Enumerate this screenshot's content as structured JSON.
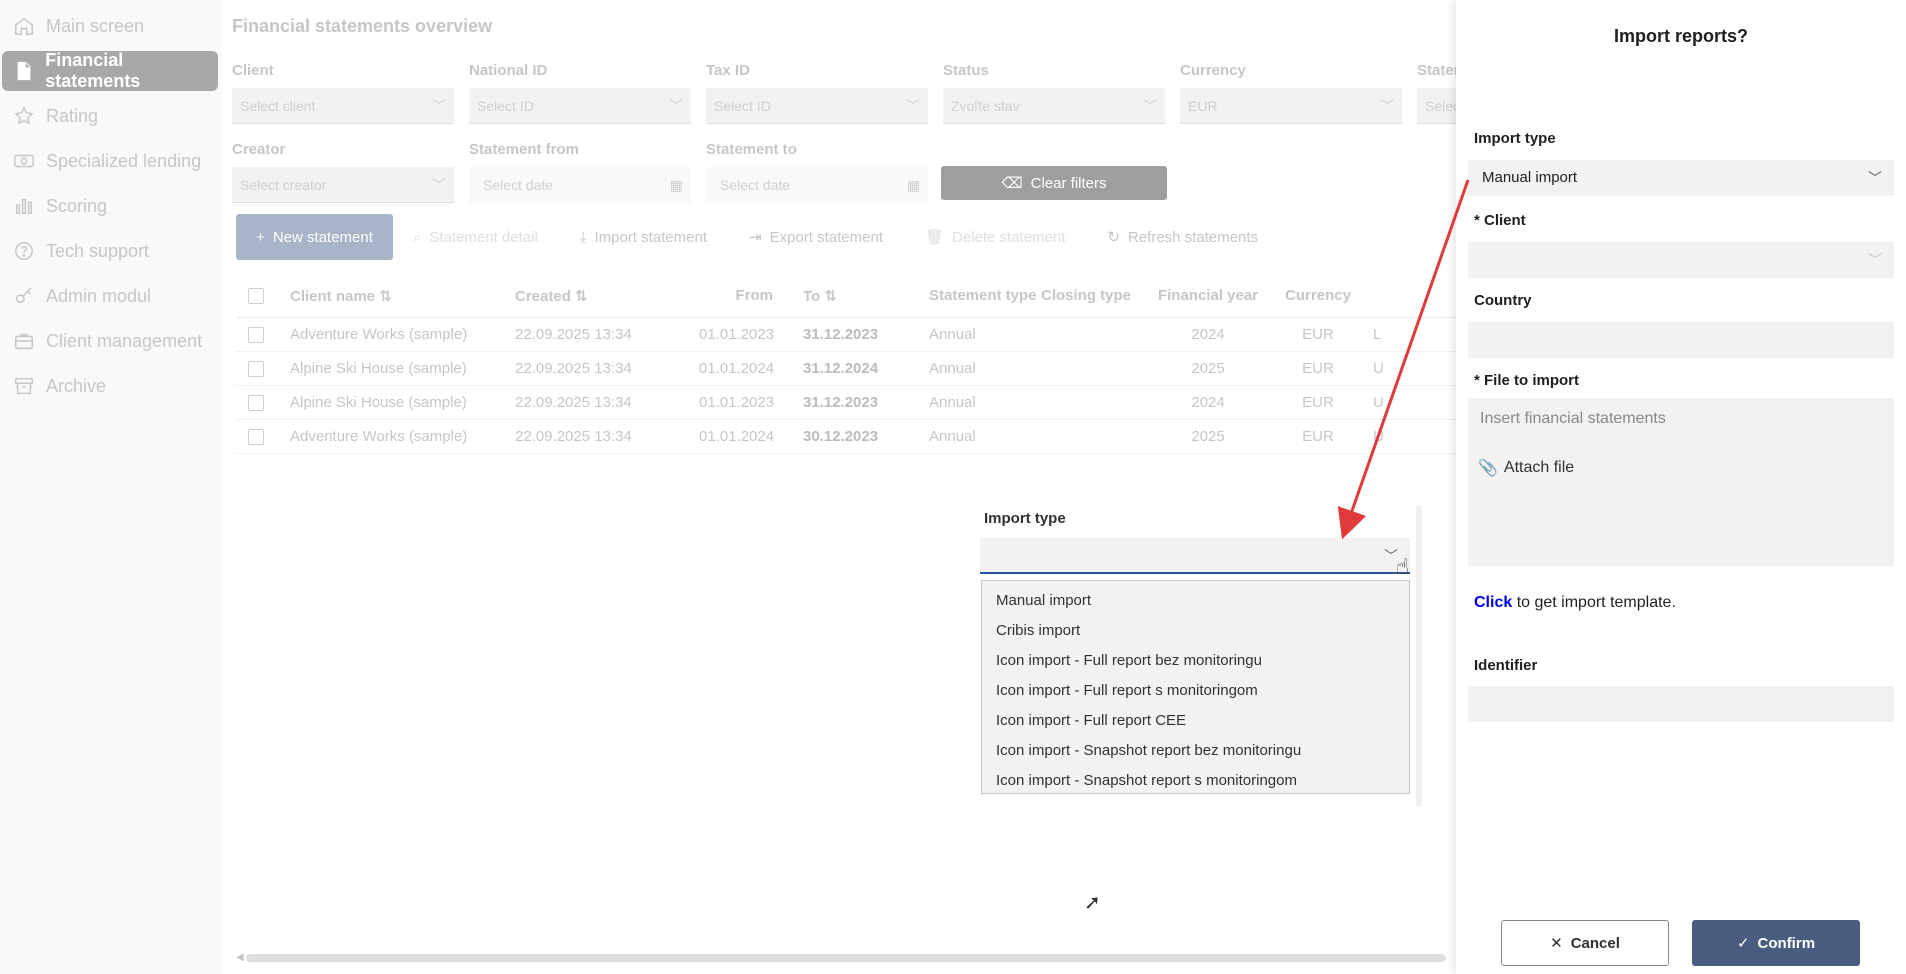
{
  "sidebar": {
    "items": [
      {
        "label": "Main screen",
        "icon": "home-icon"
      },
      {
        "label": "Financial statements",
        "icon": "document-icon",
        "active": true
      },
      {
        "label": "Rating",
        "icon": "star-icon"
      },
      {
        "label": "Specialized lending",
        "icon": "money-icon"
      },
      {
        "label": "Scoring",
        "icon": "bar-chart-icon"
      },
      {
        "label": "Tech support",
        "icon": "question-icon"
      },
      {
        "label": "Admin modul",
        "icon": "key-icon"
      },
      {
        "label": "Client management",
        "icon": "briefcase-icon"
      },
      {
        "label": "Archive",
        "icon": "archive-icon"
      }
    ]
  },
  "main": {
    "title": "Financial statements overview",
    "filters": {
      "client": {
        "label": "Client",
        "placeholder": "Select client"
      },
      "national_id": {
        "label": "National ID",
        "placeholder": "Select ID"
      },
      "tax_id": {
        "label": "Tax ID",
        "placeholder": "Select ID"
      },
      "status": {
        "label": "Status",
        "placeholder": "Zvoľte stav"
      },
      "currency": {
        "label": "Currency",
        "value": "EUR"
      },
      "statement": {
        "label": "Statem",
        "placeholder": "Select"
      },
      "creator": {
        "label": "Creator",
        "placeholder": "Select creator"
      },
      "statement_from": {
        "label": "Statement from",
        "placeholder": "Select date"
      },
      "statement_to": {
        "label": "Statement to",
        "placeholder": "Select date"
      },
      "clear_label": "Clear filters"
    },
    "toolbar": {
      "new_statement": "New statement",
      "statement_detail": "Statement detail",
      "import_statement": "Import statement",
      "export_statement": "Export statement",
      "delete_statement": "Delete statement",
      "refresh_statements": "Refresh statements"
    },
    "table": {
      "headers": {
        "client_name": "Client name",
        "created": "Created",
        "from": "From",
        "to": "To",
        "statement_type": "Statement type",
        "closing_type": "Closing type",
        "financial_year": "Financial year",
        "currency": "Currency"
      },
      "rows": [
        {
          "client": "Adventure Works (sample)",
          "created": "22.09.2025 13:34",
          "from": "01.01.2023",
          "to": "31.12.2023",
          "type": "Annual",
          "closing": "",
          "year": "2024",
          "currency": "EUR",
          "extra": "L"
        },
        {
          "client": "Alpine Ski House (sample)",
          "created": "22.09.2025 13:34",
          "from": "01.01.2024",
          "to": "31.12.2024",
          "type": "Annual",
          "closing": "",
          "year": "2025",
          "currency": "EUR",
          "extra": "U"
        },
        {
          "client": "Alpine Ski House (sample)",
          "created": "22.09.2025 13:34",
          "from": "01.01.2023",
          "to": "31.12.2023",
          "type": "Annual",
          "closing": "",
          "year": "2024",
          "currency": "EUR",
          "extra": "U"
        },
        {
          "client": "Adventure Works (sample)",
          "created": "22.09.2025 13:34",
          "from": "01.01.2024",
          "to": "30.12.2023",
          "type": "Annual",
          "closing": "",
          "year": "2025",
          "currency": "EUR",
          "extra": "U"
        }
      ]
    }
  },
  "dropdown_demo": {
    "label": "Import type",
    "value": "",
    "options": [
      "Manual import",
      "Cribis import",
      "Icon import - Full report bez monitoringu",
      "Icon import - Full report s monitoringom",
      "Icon import - Full report CEE",
      "Icon import - Snapshot report bez monitoringu",
      "Icon import - Snapshot report s monitoringom"
    ]
  },
  "panel": {
    "title": "Import reports?",
    "import_type_label": "Import type",
    "import_type_value": "Manual import",
    "client_label": "* Client",
    "client_value": "",
    "country_label": "Country",
    "country_value": "",
    "file_label": "* File to import",
    "file_placeholder": "Insert financial statements",
    "attach_label": "Attach file",
    "template_link": "Click",
    "template_text": " to get import template.",
    "identifier_label": "Identifier",
    "identifier_value": "",
    "cancel_label": "Cancel",
    "confirm_label": "Confirm"
  },
  "colors": {
    "accent": "#4a5d80",
    "arrow": "#e03a3a",
    "link": "#0000ee",
    "focus_underline": "#2b5797"
  }
}
